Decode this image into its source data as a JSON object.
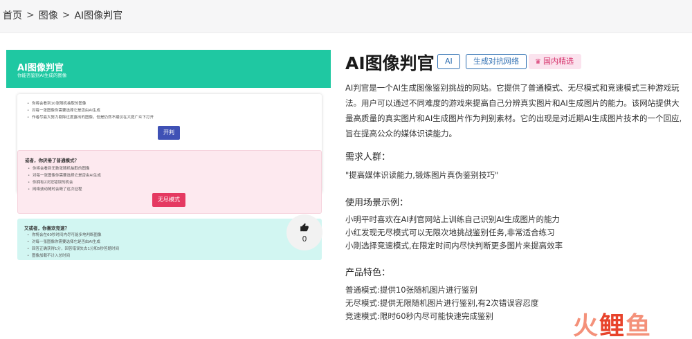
{
  "breadcrumb": [
    "首页",
    "图像",
    "AI图像判官"
  ],
  "breadcrumb_sep": ">",
  "preview": {
    "app_title": "AI图像判官",
    "app_subtitle": "你能否鉴别AI生成的图像",
    "normal": {
      "items": [
        "你将会看到10张随机抽取的图像",
        "对每一张图像你需要选择它是否由AI生成",
        "作者尽最大努力剔除过度露出的图像，但是仍然不建议在大庭广众下打开"
      ],
      "button": "开判"
    },
    "endless": {
      "title": "或者，你厌倦了普通模式？",
      "items": [
        "你将会看到无数张随机抽取的图像",
        "对每一张图像你需要选择它是否由AI生成",
        "你拥有2次犯错误的机会",
        "网络波动随时会毁了这次征程"
      ],
      "button": "无尽模式"
    },
    "race": {
      "title": "又或者，你喜欢竞速？",
      "items": [
        "你将会在60秒时间内尽可能多地判断图像",
        "对每一张图像你需要选择它是否由AI生成",
        "回答正确获得1分，回答错误失去1分和5秒答题时间",
        "图像加载不计入总时间"
      ]
    },
    "likes": "0"
  },
  "product": {
    "title": "AI图像判官",
    "tags": [
      "AI",
      "生成对抗网络"
    ],
    "badge": "国内精选",
    "description": "AI判官是一个AI生成图像鉴别挑战的网站。它提供了普通模式、无尽模式和竞速模式三种游戏玩法。用户可以通过不同难度的游戏来提高自己分辨真实图片和AI生成图片的能力。该网站提供大量高质量的真实图片和AI生成图片作为判别素材。它的出现是对近期AI生成图片技术的一个回应,旨在提高公众的媒体识读能力。"
  },
  "sections": {
    "audience_title": "需求人群：",
    "audience_text": "\"提高媒体识读能力,锻炼图片真伪鉴别技巧\"",
    "scenarios_title": "使用场景示例：",
    "scenarios": [
      "小明平时喜欢在AI判官网站上训练自己识别AI生成图片的能力",
      "小红发现无尽模式可以无限次地挑战鉴别任务,非常适合练习",
      "小刚选择竞速模式,在限定时间内尽快判断更多图片来提高效率"
    ],
    "features_title": "产品特色：",
    "features": [
      "普通模式:提供10张随机图片进行鉴别",
      "无尽模式:提供无限随机图片进行鉴别,有2次错误容忍度",
      "竞速模式:限时60秒内尽可能快速完成鉴别"
    ]
  },
  "watermark": {
    "part1": "火",
    "part2": "鲤",
    "part3": "鱼"
  },
  "colors": {
    "teal": "#1fc8a2",
    "indigo": "#3f51b5",
    "pink": "#e53961",
    "tag_blue": "#2b6cb0"
  }
}
